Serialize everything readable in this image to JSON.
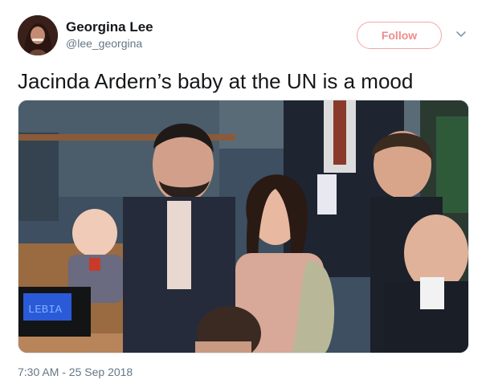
{
  "tweet": {
    "author_name": "Georgina Lee",
    "author_handle": "@lee_georgina",
    "follow_label": "Follow",
    "text": "Jacinda Ardern’s baby at the UN is a mood",
    "timestamp": "7:30 AM - 25 Sep 2018",
    "accent_color": "#f08a8a"
  },
  "media": {
    "desk_display_text": "LEBIA"
  },
  "icons": {
    "more": "chevron-down-icon",
    "avatar": "avatar-photo"
  }
}
